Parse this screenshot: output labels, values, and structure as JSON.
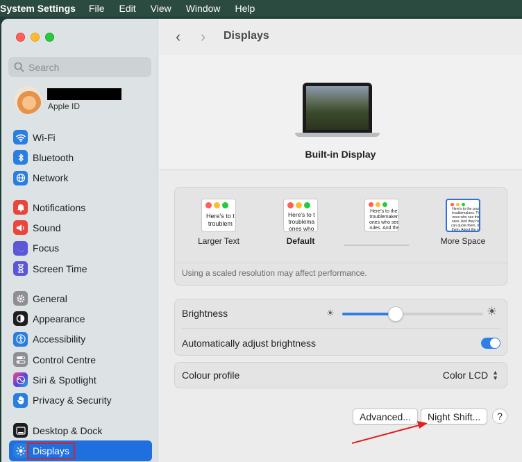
{
  "menubar": {
    "app_name": "System Settings",
    "items": [
      "File",
      "Edit",
      "View",
      "Window",
      "Help"
    ]
  },
  "sidebar": {
    "search_placeholder": "Search",
    "account": {
      "subtitle": "Apple ID"
    },
    "groups": [
      [
        {
          "label": "Wi-Fi",
          "icon": "wifi-icon",
          "color": "#2a7de1"
        },
        {
          "label": "Bluetooth",
          "icon": "bluetooth-icon",
          "color": "#2a7de1"
        },
        {
          "label": "Network",
          "icon": "globe-icon",
          "color": "#2a7de1"
        }
      ],
      [
        {
          "label": "Notifications",
          "icon": "bell-icon",
          "color": "#e9453a"
        },
        {
          "label": "Sound",
          "icon": "speaker-icon",
          "color": "#e9453a"
        },
        {
          "label": "Focus",
          "icon": "moon-icon",
          "color": "#5b57d6"
        },
        {
          "label": "Screen Time",
          "icon": "hourglass-icon",
          "color": "#5b57d6"
        }
      ],
      [
        {
          "label": "General",
          "icon": "gear-icon",
          "color": "#8e8e93"
        },
        {
          "label": "Appearance",
          "icon": "appearance-icon",
          "color": "#1d1d1f"
        },
        {
          "label": "Accessibility",
          "icon": "accessibility-icon",
          "color": "#2a7de1"
        },
        {
          "label": "Control Centre",
          "icon": "switches-icon",
          "color": "#8e8e93"
        },
        {
          "label": "Siri & Spotlight",
          "icon": "siri-icon",
          "color": "#b43ec9"
        },
        {
          "label": "Privacy & Security",
          "icon": "hand-icon",
          "color": "#2a7de1"
        }
      ],
      [
        {
          "label": "Desktop & Dock",
          "icon": "dock-icon",
          "color": "#1d1d1f"
        },
        {
          "label": "Displays",
          "icon": "sun-icon",
          "color": "#2a7de1",
          "selected": true
        }
      ]
    ]
  },
  "main": {
    "title": "Displays",
    "display_name": "Built-in Display",
    "resolution_options": [
      {
        "label": "Larger Text",
        "sample_text": "Here's to t\ntroublem"
      },
      {
        "label": "Default",
        "sample_text": "Here's to t\ntroublema\nones who",
        "bold": true
      },
      {
        "label": "",
        "sample_text": "Here's to the c\ntroublemakers.\nones who see t\nrules. And they"
      },
      {
        "label": "More Space",
        "sample_text": "Here's to the crazy one\ntroublemakers. The rou\nones who see things di\nrules. And they have no\ncan quote them, disagre\nthem. About the only thi\nBecause they change th"
      }
    ],
    "resolution_note": "Using a scaled resolution may affect performance.",
    "brightness_label": "Brightness",
    "brightness_level": 0.38,
    "auto_brightness_label": "Automatically adjust brightness",
    "auto_brightness_on": true,
    "colour_profile_label": "Colour profile",
    "colour_profile_value": "Color LCD",
    "buttons": {
      "advanced": "Advanced...",
      "night_shift": "Night Shift...",
      "help": "?"
    }
  },
  "colors": {
    "accent": "#2f7fe6",
    "selection": "#1f6fde",
    "annotation": "#e02020"
  }
}
